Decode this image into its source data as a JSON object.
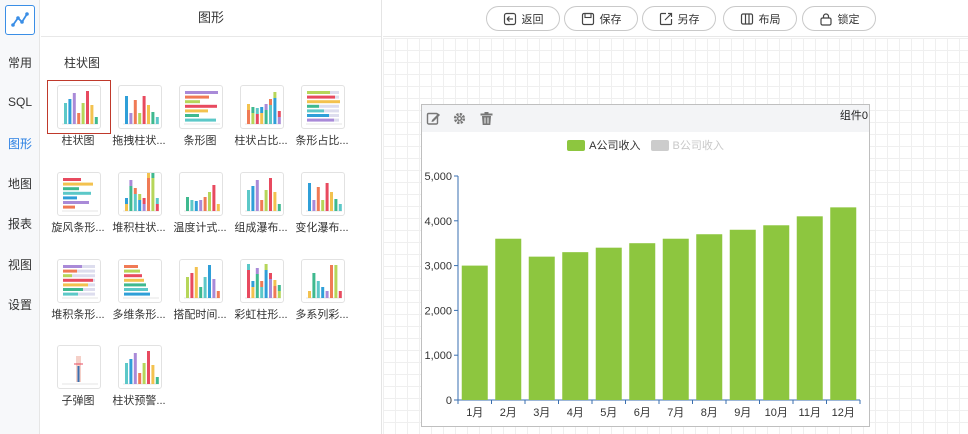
{
  "rail": {
    "items": [
      {
        "label": "常用"
      },
      {
        "label": "SQL"
      },
      {
        "label": "图形",
        "active": true
      },
      {
        "label": "地图"
      },
      {
        "label": "报表"
      },
      {
        "label": "视图"
      },
      {
        "label": "设置"
      }
    ]
  },
  "panel": {
    "title": "图形",
    "section": "柱状图",
    "tiles": [
      {
        "label": "柱状图",
        "icon": "bar-chart-icon",
        "selected": true
      },
      {
        "label": "拖拽柱状...",
        "icon": "drag-bar-chart-icon"
      },
      {
        "label": "条形图",
        "icon": "horizontal-bar-chart-icon"
      },
      {
        "label": "柱状占比...",
        "icon": "stacked-percent-bar-icon"
      },
      {
        "label": "条形占比...",
        "icon": "horizontal-percent-bar-icon"
      },
      {
        "label": "旋风条形...",
        "icon": "tornado-bar-icon"
      },
      {
        "label": "堆积柱状...",
        "icon": "stacked-bar-icon"
      },
      {
        "label": "温度计式...",
        "icon": "thermometer-bar-icon"
      },
      {
        "label": "组成瀑布...",
        "icon": "composition-waterfall-icon"
      },
      {
        "label": "变化瀑布...",
        "icon": "change-waterfall-icon"
      },
      {
        "label": "堆积条形...",
        "icon": "stacked-horizontal-bar-icon"
      },
      {
        "label": "多维条形...",
        "icon": "multi-dim-bar-icon"
      },
      {
        "label": "搭配时间...",
        "icon": "timeline-bar-icon"
      },
      {
        "label": "彩虹柱形...",
        "icon": "rainbow-bar-icon"
      },
      {
        "label": "多系列彩...",
        "icon": "multi-series-color-bar-icon"
      },
      {
        "label": "子弹图",
        "icon": "bullet-chart-icon"
      },
      {
        "label": "柱状预警...",
        "icon": "warning-bar-icon"
      }
    ]
  },
  "toolbar": {
    "back": "返回",
    "save": "保存",
    "save_as": "另存",
    "layout": "布局",
    "lock": "锁定"
  },
  "widget": {
    "name": "组件0",
    "colors": {
      "a": "#8dc63f",
      "b": "#cccccc",
      "axis": "#3a6fb0"
    }
  },
  "chart_data": {
    "type": "bar",
    "categories": [
      "1月",
      "2月",
      "3月",
      "4月",
      "5月",
      "6月",
      "7月",
      "8月",
      "9月",
      "10月",
      "11月",
      "12月"
    ],
    "series": [
      {
        "name": "A公司收入",
        "values": [
          3000,
          3600,
          3200,
          3300,
          3400,
          3500,
          3600,
          3700,
          3800,
          3900,
          4100,
          4300
        ],
        "visible": true
      },
      {
        "name": "B公司收入",
        "values": [],
        "visible": false
      }
    ],
    "yticks": [
      "0",
      "1,000",
      "2,000",
      "3,000",
      "4,000",
      "5,000"
    ],
    "ylim": [
      0,
      5000
    ],
    "legend": "top-center",
    "grid": false
  }
}
